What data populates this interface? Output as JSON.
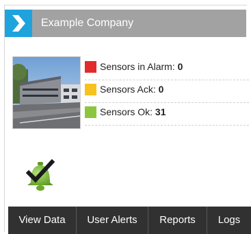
{
  "header": {
    "company_name": "Example Company",
    "logo_icon": "chevron-right-icon",
    "logo_color": "#1fa3dc"
  },
  "status": {
    "items": [
      {
        "label": "Sensors in Alarm:",
        "value": "0",
        "color": "#e22b2b"
      },
      {
        "label": "Sensors Ack:",
        "value": "0",
        "color": "#f7c21d"
      },
      {
        "label": "Sensors Ok:",
        "value": "31",
        "color": "#8cc63f"
      }
    ]
  },
  "bell_icon": "bell-check-icon",
  "nav": {
    "items": [
      "View Data",
      "User Alerts",
      "Reports",
      "Logs"
    ]
  }
}
